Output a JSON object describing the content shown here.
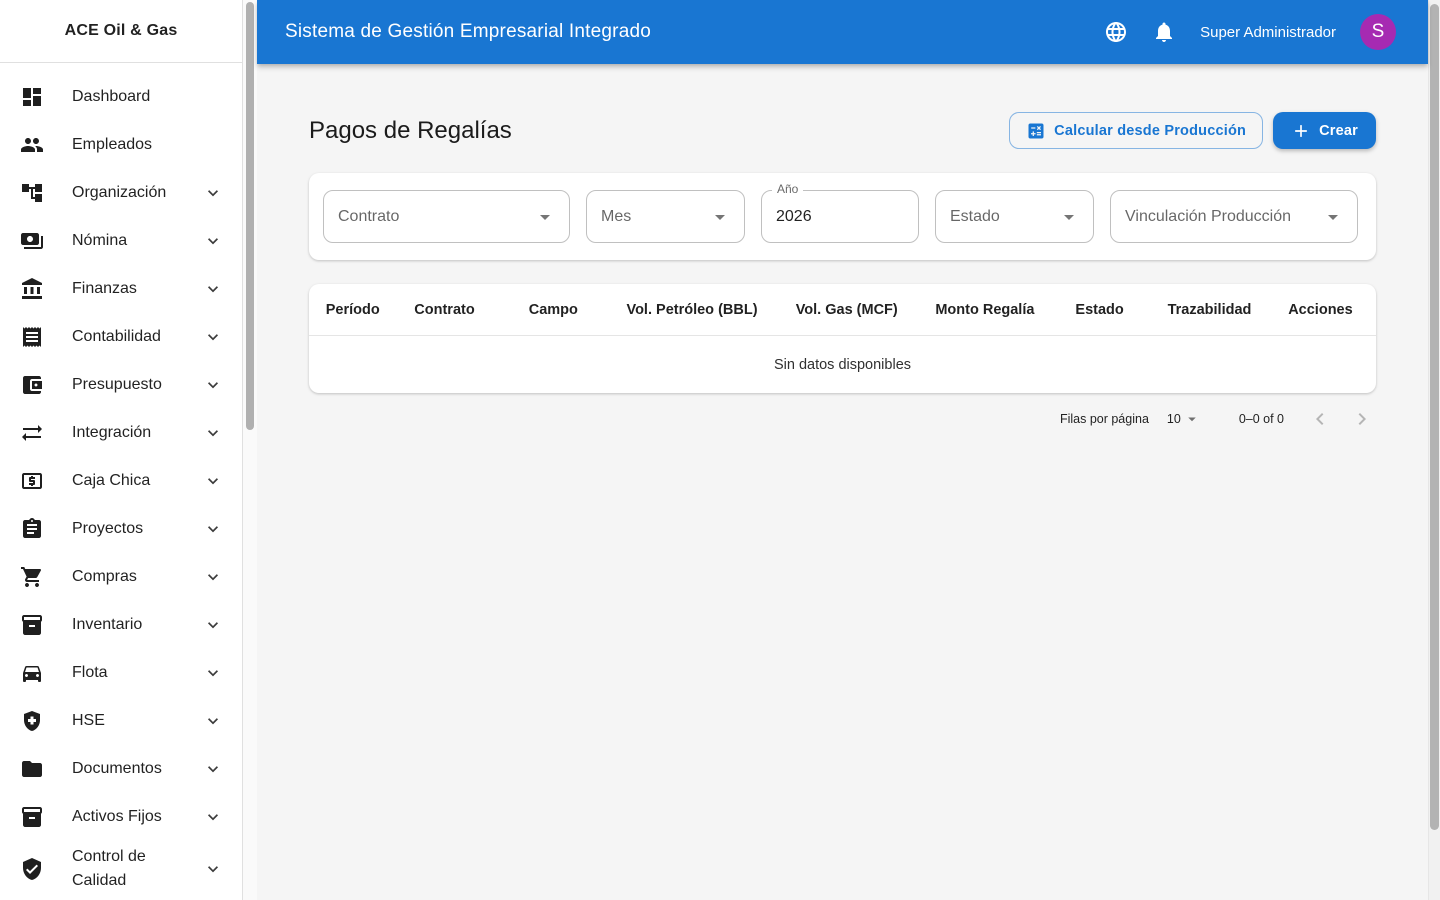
{
  "sidebar": {
    "brand": "ACE Oil & Gas",
    "items": [
      {
        "label": "Dashboard",
        "icon": "dashboard-icon",
        "expandable": false
      },
      {
        "label": "Empleados",
        "icon": "people-icon",
        "expandable": false
      },
      {
        "label": "Organización",
        "icon": "org-tree-icon",
        "expandable": true
      },
      {
        "label": "Nómina",
        "icon": "payments-icon",
        "expandable": true
      },
      {
        "label": "Finanzas",
        "icon": "bank-icon",
        "expandable": true
      },
      {
        "label": "Contabilidad",
        "icon": "receipt-icon",
        "expandable": true
      },
      {
        "label": "Presupuesto",
        "icon": "wallet-icon",
        "expandable": true
      },
      {
        "label": "Integración",
        "icon": "sync-icon",
        "expandable": true
      },
      {
        "label": "Caja Chica",
        "icon": "cash-icon",
        "expandable": true
      },
      {
        "label": "Proyectos",
        "icon": "clipboard-icon",
        "expandable": true
      },
      {
        "label": "Compras",
        "icon": "cart-icon",
        "expandable": true
      },
      {
        "label": "Inventario",
        "icon": "inventory-icon",
        "expandable": true
      },
      {
        "label": "Flota",
        "icon": "car-icon",
        "expandable": true
      },
      {
        "label": "HSE",
        "icon": "shield-plus-icon",
        "expandable": true
      },
      {
        "label": "Documentos",
        "icon": "folder-icon",
        "expandable": true
      },
      {
        "label": "Activos Fijos",
        "icon": "inventory-icon",
        "expandable": true
      },
      {
        "label": "Control de Calidad",
        "icon": "shield-check-icon",
        "expandable": true
      }
    ]
  },
  "appbar": {
    "title": "Sistema de Gestión Empresarial Integrado",
    "user": "Super Administrador",
    "avatar_initial": "S"
  },
  "page": {
    "title": "Pagos de Regalías",
    "calc_button": "Calcular desde Producción",
    "create_button": "Crear"
  },
  "filters": {
    "contrato": {
      "label": "Contrato"
    },
    "mes": {
      "label": "Mes"
    },
    "anio": {
      "label": "Año",
      "value": "2026"
    },
    "estado": {
      "label": "Estado"
    },
    "vinculacion": {
      "label": "Vinculación Producción"
    }
  },
  "table": {
    "columns": [
      "Período",
      "Contrato",
      "Campo",
      "Vol. Petróleo (BBL)",
      "Vol. Gas (MCF)",
      "Monto Regalía",
      "Estado",
      "Trazabilidad",
      "Acciones"
    ],
    "empty_text": "Sin datos disponibles"
  },
  "pagination": {
    "rows_per_page_label": "Filas por página",
    "rows_per_page_value": "10",
    "range_text": "0–0 of 0"
  },
  "colors": {
    "primary": "#1976d2",
    "avatar": "#a62ab2"
  }
}
